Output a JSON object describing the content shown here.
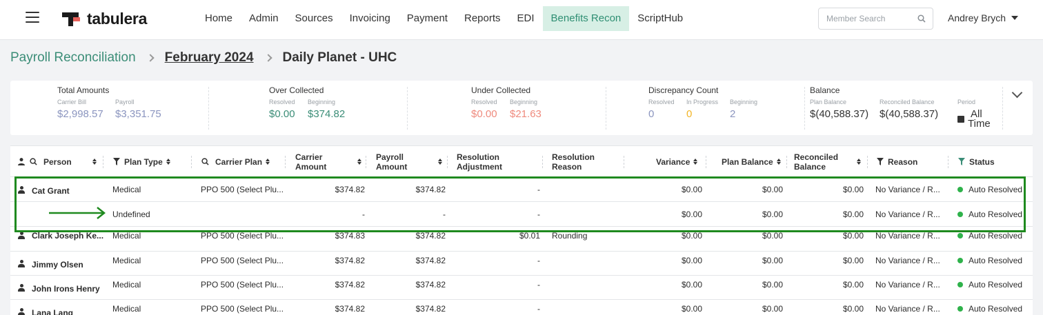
{
  "app": {
    "logo_text": "tabulera",
    "nav": [
      "Home",
      "Admin",
      "Sources",
      "Invoicing",
      "Payment",
      "Reports",
      "EDI",
      "Benefits Recon",
      "ScriptHub"
    ],
    "active_nav": "Benefits Recon",
    "search_placeholder": "Member Search",
    "user_name": "Andrey Brych"
  },
  "breadcrumb": {
    "level1": "Payroll Reconciliation",
    "level2": "February 2024",
    "level3": "Daily Planet - UHC"
  },
  "summary": {
    "total_amounts": {
      "title": "Total Amounts",
      "carrier_bill_label": "Carrier Bill",
      "carrier_bill": "$2,998.57",
      "payroll_label": "Payroll",
      "payroll": "$3,351.75"
    },
    "over_collected": {
      "title": "Over Collected",
      "resolved_label": "Resolved",
      "resolved": "$0.00",
      "beginning_label": "Beginning",
      "beginning": "$374.82"
    },
    "under_collected": {
      "title": "Under Collected",
      "resolved_label": "Resolved",
      "resolved": "$0.00",
      "beginning_label": "Beginning",
      "beginning": "$21.63"
    },
    "discrepancy_count": {
      "title": "Discrepancy Count",
      "resolved_label": "Resolved",
      "resolved": "0",
      "in_progress_label": "In Progress",
      "in_progress": "0",
      "beginning_label": "Beginning",
      "beginning": "2"
    },
    "balance": {
      "title": "Balance",
      "plan_balance_label": "Plan Balance",
      "plan_balance": "$(40,588.37)",
      "reconciled_balance_label": "Reconciled Balance",
      "reconciled_balance": "$(40,588.37)",
      "period_label": "Period",
      "period_line1": "All",
      "period_line2": "Time"
    }
  },
  "table": {
    "headers": {
      "person": "Person",
      "plan_type": "Plan Type",
      "carrier_plan": "Carrier Plan",
      "carrier_amount_1": "Carrier",
      "carrier_amount_2": "Amount",
      "payroll_amount_1": "Payroll",
      "payroll_amount_2": "Amount",
      "resolution_adjustment_1": "Resolution",
      "resolution_adjustment_2": "Adjustment",
      "resolution_reason_1": "Resolution",
      "resolution_reason_2": "Reason",
      "variance": "Variance",
      "plan_balance": "Plan Balance",
      "reconciled_balance_1": "Reconciled",
      "reconciled_balance_2": "Balance",
      "reason": "Reason",
      "status": "Status"
    },
    "rows": [
      {
        "person": "Cat Grant",
        "plan_type": "Medical",
        "carrier_plan": "PPO 500 (Select Plu...",
        "carrier_amount": "$374.82",
        "payroll_amount": "$374.82",
        "resolution_adjustment": "-",
        "resolution_reason": "",
        "variance": "$0.00",
        "plan_balance": "$0.00",
        "reconciled_balance": "$0.00",
        "reason": "No Variance / R...",
        "status": "Auto Resolved"
      },
      {
        "person": "",
        "plan_type": "Undefined",
        "carrier_plan": "",
        "carrier_amount": "-",
        "payroll_amount": "-",
        "resolution_adjustment": "-",
        "resolution_reason": "",
        "variance": "$0.00",
        "plan_balance": "$0.00",
        "reconciled_balance": "$0.00",
        "reason": "No Variance / R...",
        "status": "Auto Resolved"
      },
      {
        "person": "Clark Joseph Ke...",
        "plan_type": "Medical",
        "carrier_plan": "PPO 500 (Select Plu...",
        "carrier_amount": "$374.83",
        "payroll_amount": "$374.82",
        "resolution_adjustment": "$0.01",
        "resolution_reason": "Rounding",
        "variance": "$0.00",
        "plan_balance": "$0.00",
        "reconciled_balance": "$0.00",
        "reason": "No Variance / R...",
        "status": "Auto Resolved"
      },
      {
        "person": "Jimmy Olsen",
        "plan_type": "Medical",
        "carrier_plan": "PPO 500 (Select Plu...",
        "carrier_amount": "$374.82",
        "payroll_amount": "$374.82",
        "resolution_adjustment": "-",
        "resolution_reason": "",
        "variance": "$0.00",
        "plan_balance": "$0.00",
        "reconciled_balance": "$0.00",
        "reason": "No Variance / R...",
        "status": "Auto Resolved"
      },
      {
        "person": "John Irons Henry",
        "plan_type": "Medical",
        "carrier_plan": "PPO 500 (Select Plu...",
        "carrier_amount": "$374.82",
        "payroll_amount": "$374.82",
        "resolution_adjustment": "-",
        "resolution_reason": "",
        "variance": "$0.00",
        "plan_balance": "$0.00",
        "reconciled_balance": "$0.00",
        "reason": "No Variance / R...",
        "status": "Auto Resolved"
      },
      {
        "person": "Lana Lang",
        "plan_type": "Medical",
        "carrier_plan": "PPO 500 (Select Plu...",
        "carrier_amount": "$374.82",
        "payroll_amount": "$374.82",
        "resolution_adjustment": "-",
        "resolution_reason": "",
        "variance": "$0.00",
        "plan_balance": "$0.00",
        "reconciled_balance": "$0.00",
        "reason": "No Variance / R...",
        "status": "Auto Resolved"
      }
    ]
  },
  "colors": {
    "accent_green": "#3b8d77",
    "active_nav_bg": "#d7efe5",
    "highlight_box": "#1f8a1f",
    "status_dot": "#2fb24b"
  }
}
